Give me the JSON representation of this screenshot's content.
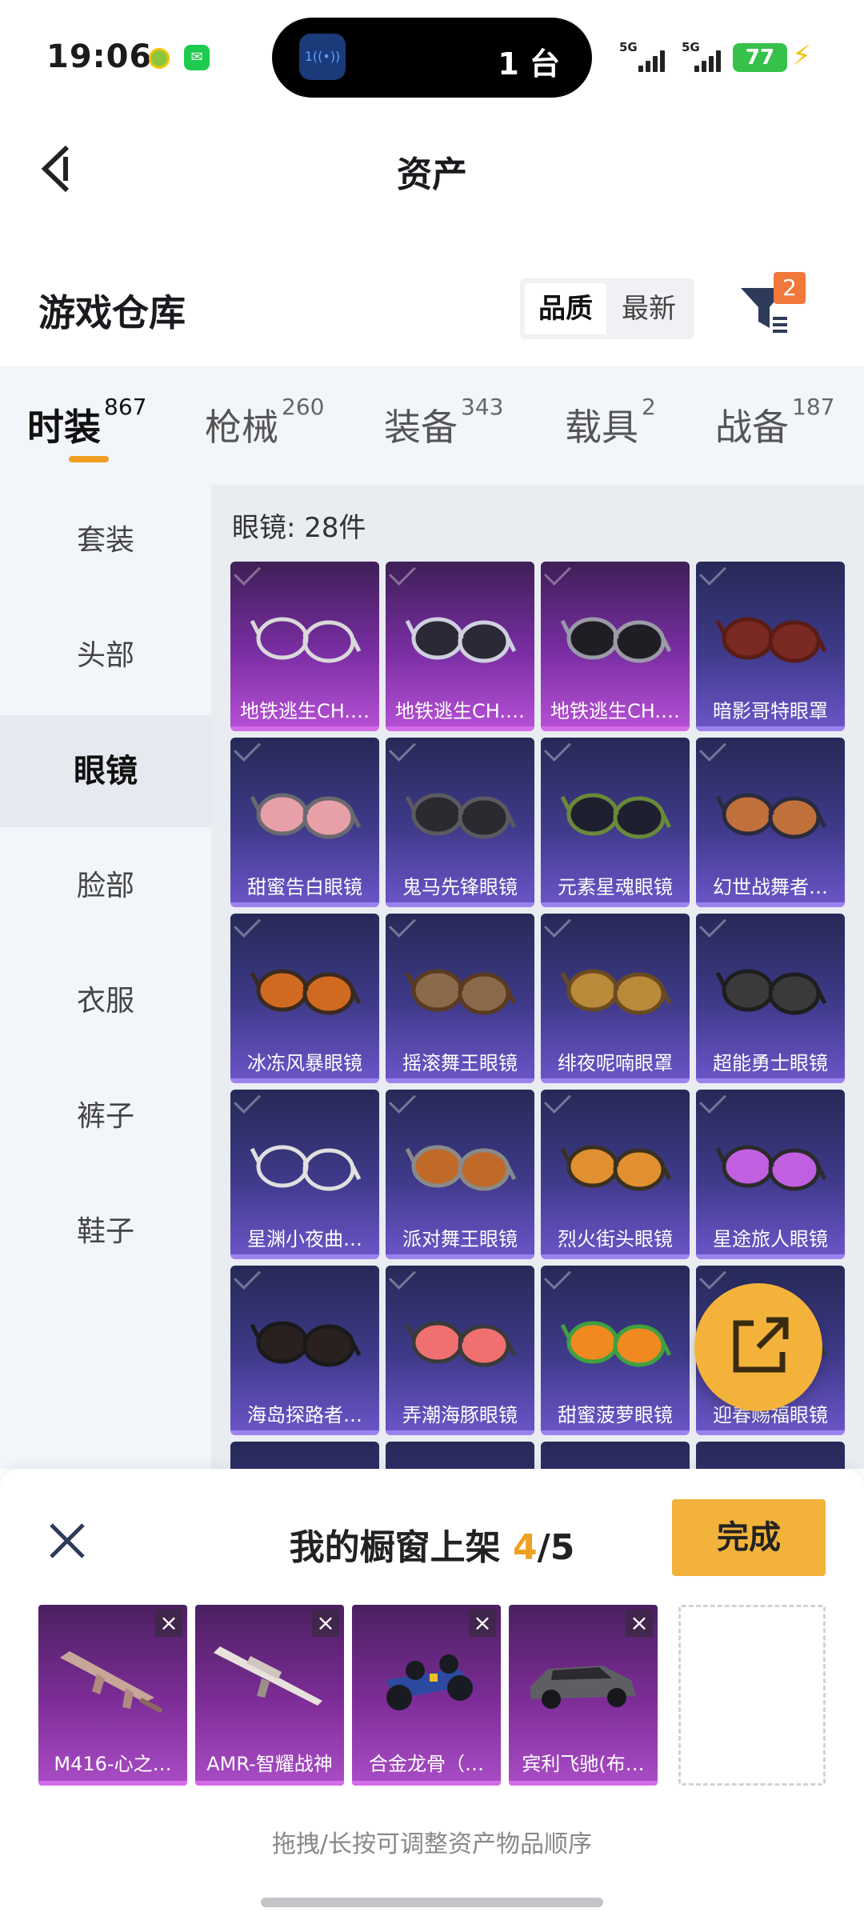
{
  "status_bar": {
    "time": "19:06",
    "island_count": "1 台",
    "island_icon": "1",
    "net1": "5G",
    "net2": "5G",
    "battery": "77"
  },
  "header": {
    "title": "资产"
  },
  "warehouse": {
    "title": "游戏仓库",
    "sort_options": [
      "品质",
      "最新"
    ],
    "filter_badge": "2"
  },
  "tabs": [
    {
      "label": "时装",
      "count": "867"
    },
    {
      "label": "枪械",
      "count": "260"
    },
    {
      "label": "装备",
      "count": "343"
    },
    {
      "label": "载具",
      "count": "2"
    },
    {
      "label": "战备",
      "count": "187"
    }
  ],
  "sidebar": {
    "items": [
      "套装",
      "头部",
      "眼镜",
      "脸部",
      "衣服",
      "裤子",
      "鞋子"
    ]
  },
  "content": {
    "count_label": "眼镜: 28件",
    "items": [
      {
        "name": "地铁逃生CH.…",
        "rarity": "purple",
        "icon": "chain-glasses-icon"
      },
      {
        "name": "地铁逃生CH.…",
        "rarity": "purple",
        "icon": "visor-goggles-icon"
      },
      {
        "name": "地铁逃生CH.…",
        "rarity": "purple",
        "icon": "tactical-glasses-icon"
      },
      {
        "name": "暗影哥特眼罩",
        "rarity": "blue",
        "icon": "eye-mask-icon"
      },
      {
        "name": "甜蜜告白眼镜",
        "rarity": "blue",
        "icon": "pink-sunglasses-icon"
      },
      {
        "name": "鬼马先锋眼镜",
        "rarity": "blue",
        "icon": "dark-sunglasses-icon"
      },
      {
        "name": "元素星魂眼镜",
        "rarity": "blue",
        "icon": "green-frame-glasses-icon"
      },
      {
        "name": "幻世战舞者…",
        "rarity": "blue",
        "icon": "gradient-sunglasses-icon"
      },
      {
        "name": "冰冻风暴眼镜",
        "rarity": "blue",
        "icon": "orange-shades-icon"
      },
      {
        "name": "摇滚舞王眼镜",
        "rarity": "blue",
        "icon": "shutter-shades-icon"
      },
      {
        "name": "绯夜呢喃眼罩",
        "rarity": "blue",
        "icon": "lace-mask-icon"
      },
      {
        "name": "超能勇士眼镜",
        "rarity": "blue",
        "icon": "black-wrap-glasses-icon"
      },
      {
        "name": "星渊小夜曲…",
        "rarity": "blue",
        "icon": "ornate-chain-icon"
      },
      {
        "name": "派对舞王眼镜",
        "rarity": "blue",
        "icon": "aviator-glasses-icon"
      },
      {
        "name": "烈火街头眼镜",
        "rarity": "blue",
        "icon": "sport-shades-icon"
      },
      {
        "name": "星途旅人眼镜",
        "rarity": "blue",
        "icon": "purple-visor-icon"
      },
      {
        "name": "海岛探路者…",
        "rarity": "blue",
        "icon": "black-sunglasses-icon"
      },
      {
        "name": "弄潮海豚眼镜",
        "rarity": "blue",
        "icon": "round-pink-glasses-icon"
      },
      {
        "name": "甜蜜菠萝眼镜",
        "rarity": "blue",
        "icon": "pineapple-glasses-icon"
      },
      {
        "name": "迎春赐福眼镜",
        "rarity": "blue",
        "icon": "festive-glasses-icon"
      }
    ]
  },
  "showcase": {
    "title_prefix": "我的橱窗上架",
    "current": "4",
    "total": "/5",
    "done_label": "完成",
    "slots": [
      {
        "name": "M416-心之…",
        "icon": "rifle-icon"
      },
      {
        "name": "AMR-智耀战神",
        "icon": "sniper-rifle-icon"
      },
      {
        "name": "合金龙骨（…",
        "icon": "race-car-icon"
      },
      {
        "name": "宾利飞驰(布…",
        "icon": "sedan-car-icon"
      }
    ],
    "remove_glyph": "×",
    "hint": "拖拽/长按可调整资产物品顺序"
  },
  "colors": {
    "accent": "#f3b33a",
    "tab_underline": "#f0a020",
    "filter_badge": "#f0783a",
    "purple_rarity": "#d46be8",
    "blue_rarity": "#9d82ef"
  }
}
